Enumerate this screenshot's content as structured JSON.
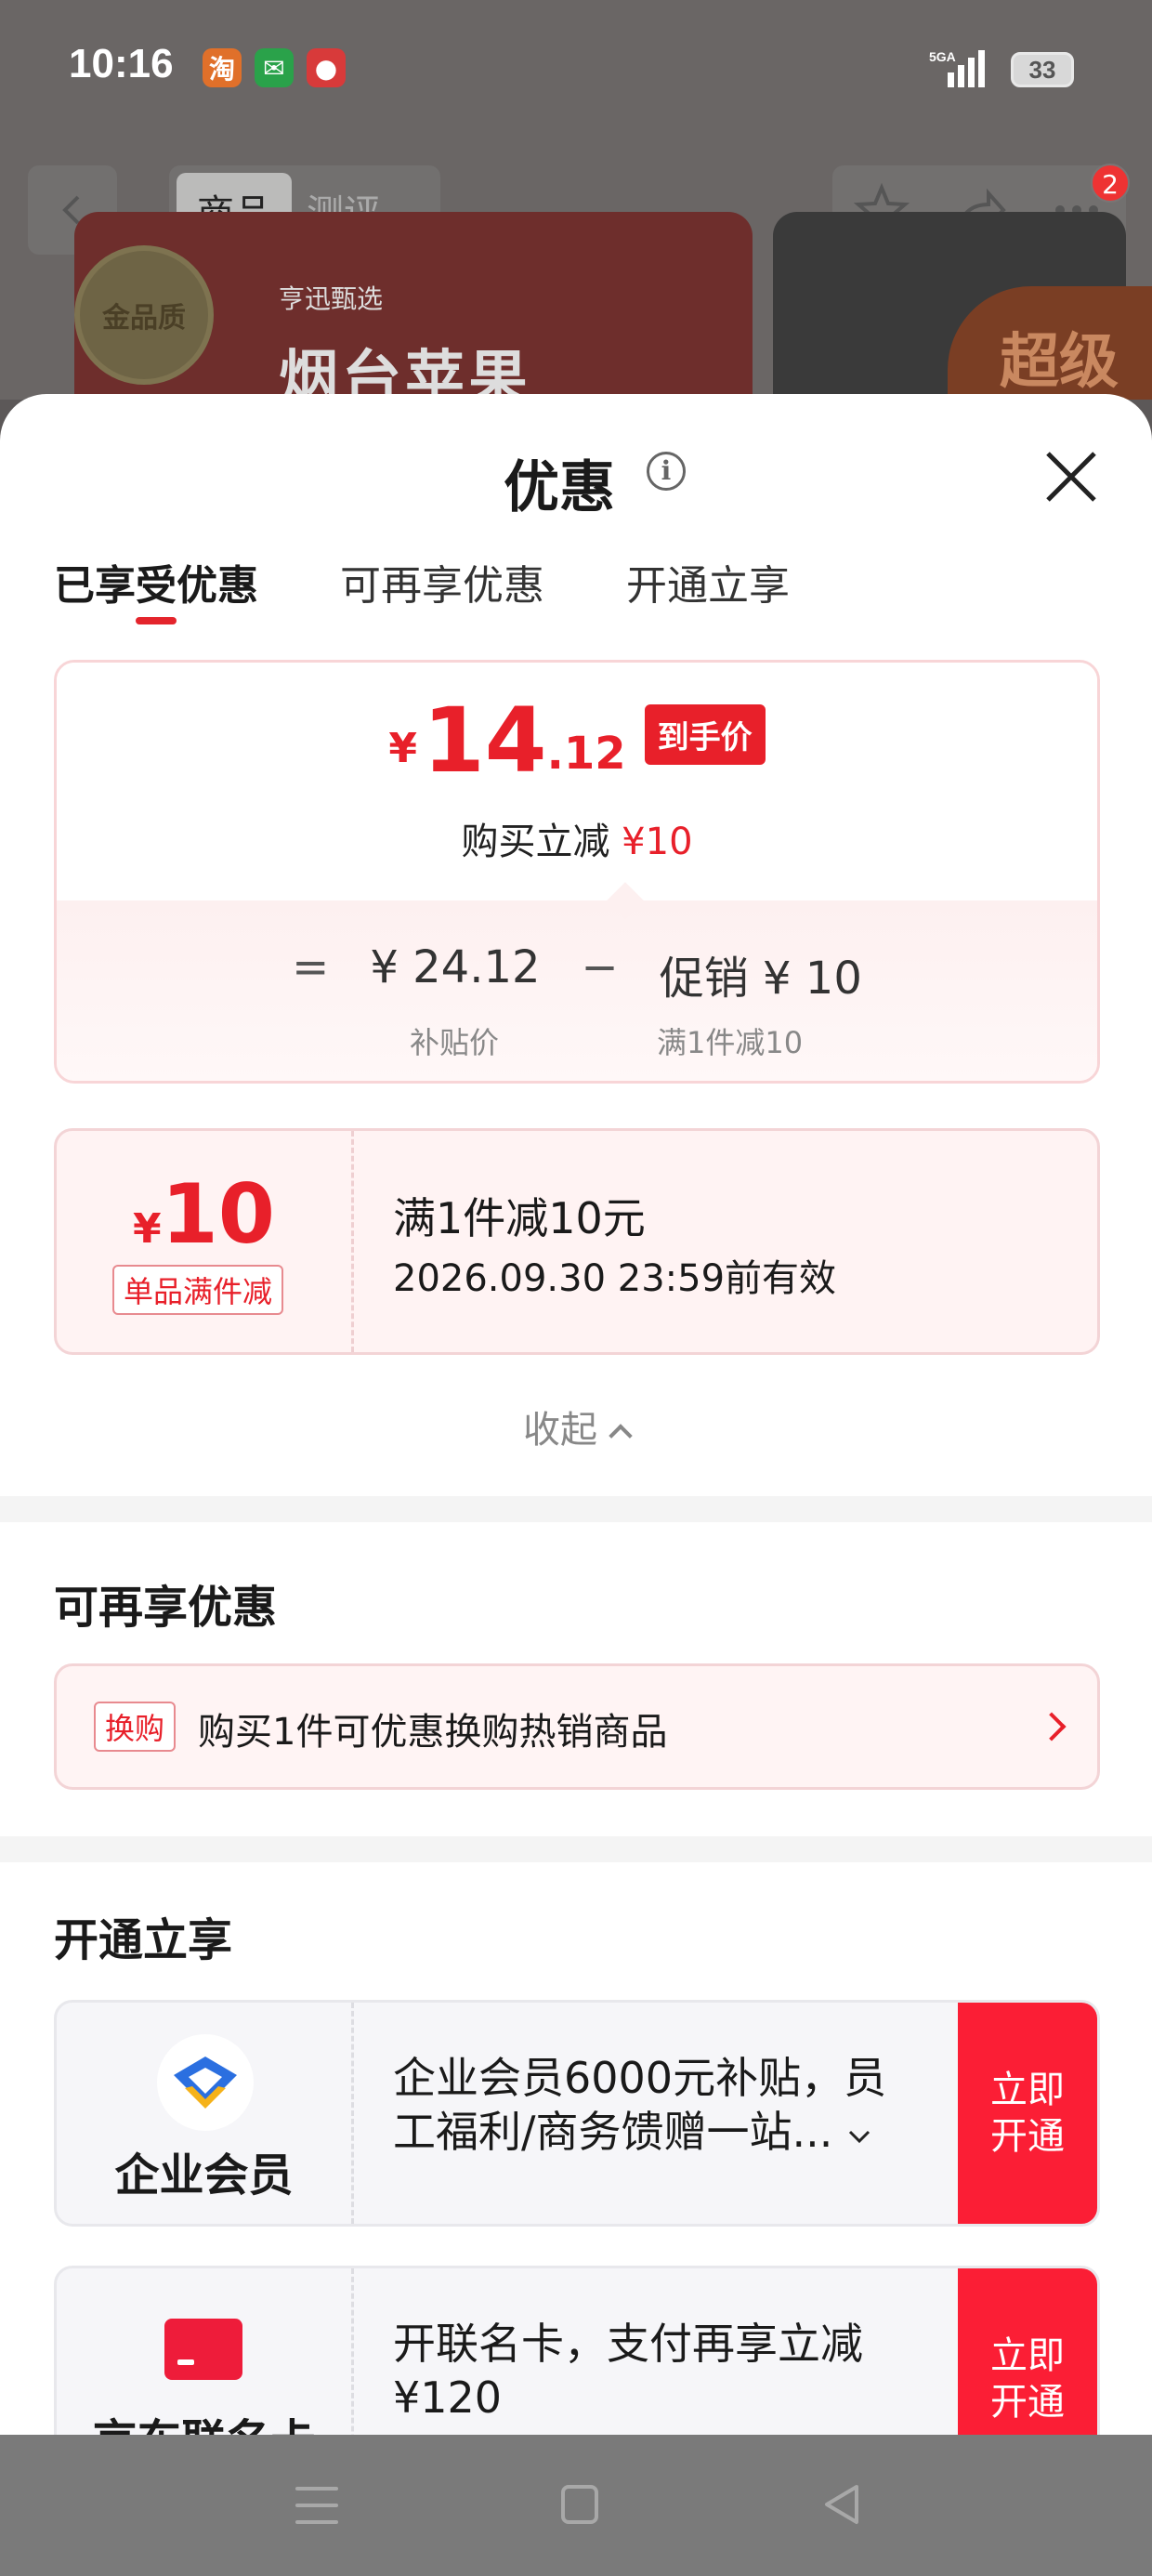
{
  "status_bar": {
    "time": "10:16",
    "network": "5GA",
    "battery": "33",
    "app_icons": [
      "taobao-icon",
      "wechat-icon",
      "app-icon"
    ]
  },
  "background_page": {
    "back_icon": "back-chevron-icon",
    "tabs": [
      "商品",
      "测评"
    ],
    "active_tab": "商品",
    "notification_count": "2",
    "medal_text": "金品质",
    "product_brand": "亨迅甄选",
    "product_title": "烟台苹果",
    "right_banner": "超级"
  },
  "sheet": {
    "title": "优惠",
    "tabs": [
      "已享受优惠",
      "可再享优惠",
      "开通立享"
    ],
    "active_tab_index": 0,
    "price_summary": {
      "currency": "¥",
      "final_int": "14",
      "final_dec": ".12",
      "final_tag": "到手价",
      "discount_prefix": "购买立减",
      "discount_value": "¥10",
      "eq": "=",
      "base_price": "¥ 24.12",
      "minus": "−",
      "promo": "促销 ¥ 10",
      "base_label": "补贴价",
      "promo_label": "满1件减10"
    },
    "coupon": {
      "currency": "¥",
      "amount": "10",
      "type": "单品满件减",
      "title": "满1件减10元",
      "expiry": "2026.09.30 23:59前有效"
    },
    "collapse_label": "收起",
    "section_more": {
      "title": "可再享优惠",
      "tag": "换购",
      "text": "购买1件可优惠换购热销商品"
    },
    "section_open": {
      "title": "开通立享",
      "cards": [
        {
          "name": "企业会员",
          "text": "企业会员6000元补贴，员工福利/商务馈赠一站...",
          "btn_line1": "立即",
          "btn_line2": "开通"
        },
        {
          "name": "京东联名卡",
          "text": "开联名卡，支付再享立减 ¥120",
          "btn_line1": "立即",
          "btn_line2": "开通"
        }
      ]
    }
  },
  "colors": {
    "accent_red": "#e8202a",
    "button_red": "#fb1e35",
    "coupon_bg": "#fff3f3"
  }
}
